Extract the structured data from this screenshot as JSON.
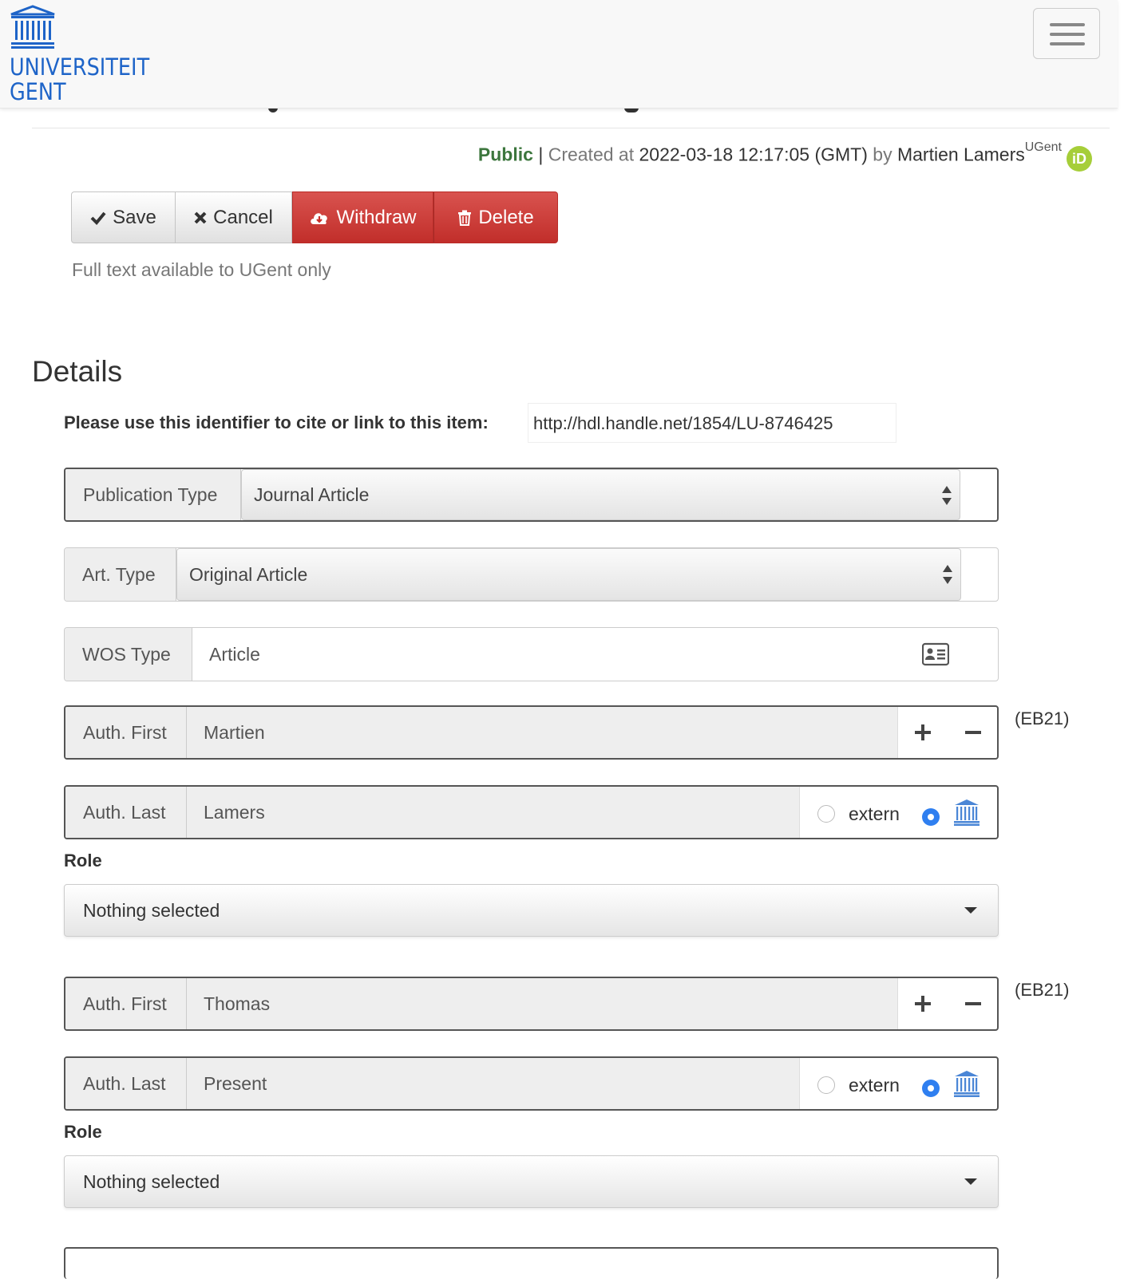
{
  "header": {
    "logo_line1": "UNIVERSITEIT",
    "logo_line2": "GENT",
    "menu_icon": "hamburger-menu-icon"
  },
  "meta": {
    "status": "Public",
    "separator": "|",
    "created_label": "Created at",
    "created_value": "2022-03-18 12:17:05 (GMT)",
    "by_label": "by",
    "author": "Martien Lamers",
    "affiliation": "UGent",
    "orcid_icon": "iD"
  },
  "toolbar": {
    "save_label": "Save",
    "cancel_label": "Cancel",
    "withdraw_label": "Withdraw",
    "delete_label": "Delete"
  },
  "access_note": "Full text available to UGent only",
  "details": {
    "heading": "Details",
    "identifier_label": "Please use this identifier to cite or link to this item",
    "identifier_colon": ":",
    "identifier_value": "http://hdl.handle.net/1854/LU-8746425"
  },
  "fields": {
    "publication_type": {
      "label": "Publication Type",
      "value": "Journal Article"
    },
    "art_type": {
      "label": "Art. Type",
      "value": "Original Article"
    },
    "wos_type": {
      "label": "WOS Type",
      "value": "Article"
    }
  },
  "authors": [
    {
      "first_label": "Auth. First",
      "first": "Martien",
      "last_label": "Auth. Last",
      "last": "Lamers",
      "code": "(EB21)",
      "extern_label": "extern",
      "role_label": "Role",
      "role_value": "Nothing selected"
    },
    {
      "first_label": "Auth. First",
      "first": "Thomas",
      "last_label": "Auth. Last",
      "last": "Present",
      "code": "(EB21)",
      "extern_label": "extern",
      "role_label": "Role",
      "role_value": "Nothing selected"
    }
  ],
  "colors": {
    "brand": "#1e64c8",
    "danger": "#d9534f",
    "public": "#3c763d",
    "orcid": "#a6ce39",
    "radio_selected": "#2f7ff0"
  }
}
